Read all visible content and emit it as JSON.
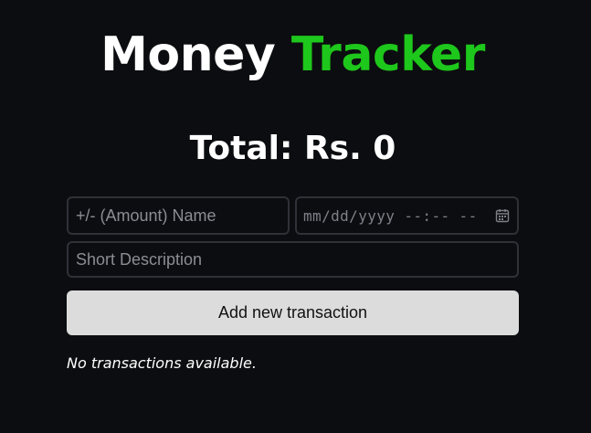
{
  "header": {
    "title_main": "Money",
    "title_accent": "Tracker",
    "accent_color": "#1ec71b"
  },
  "summary": {
    "total_label": "Total:",
    "total_amount": "Rs. 0"
  },
  "form": {
    "name_placeholder": "+/- (Amount) Name",
    "datetime_placeholder": "mm/dd/yyyy --:-- --",
    "datetime_icon": "calendar-icon",
    "description_placeholder": "Short Description",
    "submit_label": "Add new transaction"
  },
  "transactions": {
    "empty_message": "No transactions available."
  },
  "colors": {
    "background": "#0c0d10",
    "field_border": "#2f3137",
    "button_background": "#dcdcdc"
  }
}
